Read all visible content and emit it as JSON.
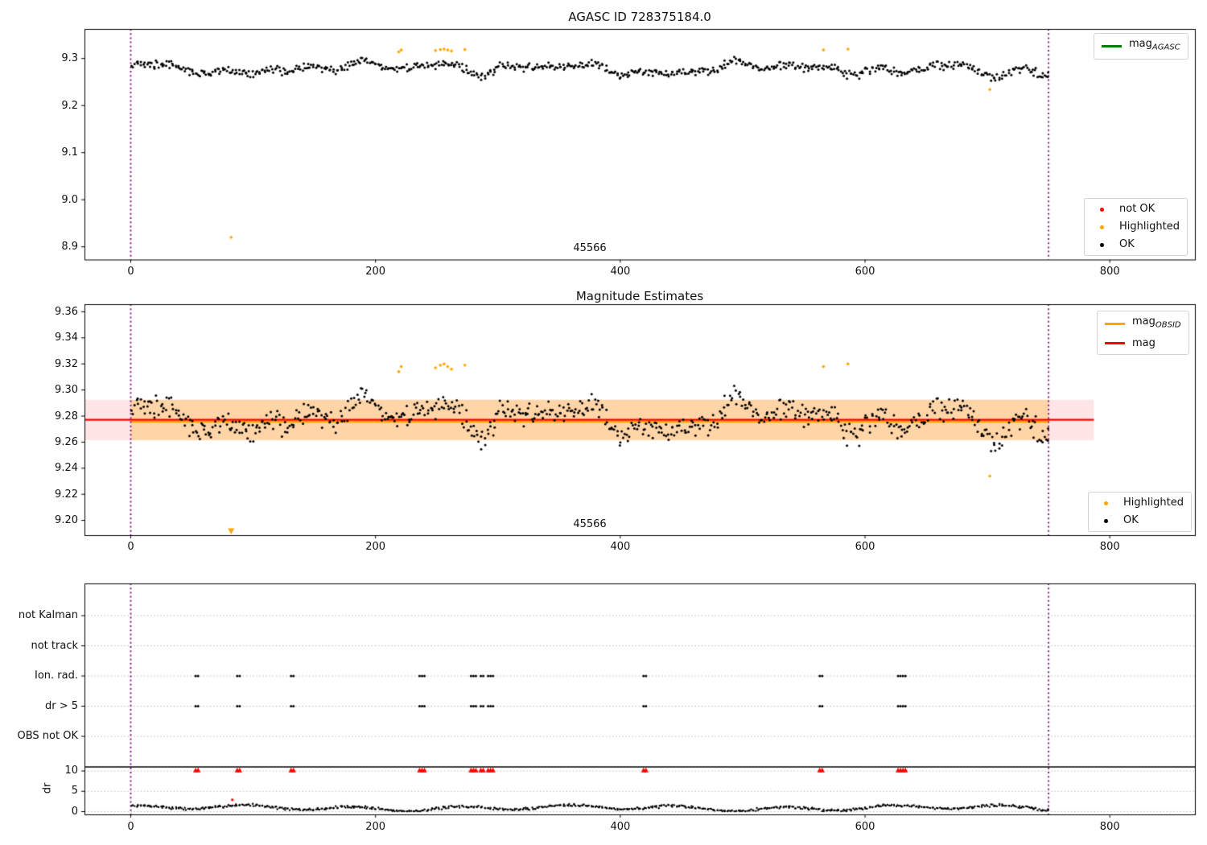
{
  "figure": {
    "background": "#ffffff"
  },
  "colors": {
    "ok": "#000000",
    "not_ok": "#ff0000",
    "highlighted": "#ffa500",
    "mag_line": "#ff0000",
    "mag_obsid_line": "#ffa500",
    "mag_agasc_line": "#008000",
    "obs_vline": "#800080",
    "grid": "#b9b9b9",
    "band_red": "rgba(255,0,0,0.10)",
    "band_orange": "rgba(255,165,0,0.28)",
    "spine": "#000000"
  },
  "plots": {
    "mag_agasc": {
      "title": "AGASC ID 728375184.0",
      "annotation": "45566",
      "xticks": [
        "0",
        "200",
        "400",
        "600",
        "800"
      ],
      "yticks": [
        "8.9",
        "9.0",
        "9.1",
        "9.2",
        "9.3"
      ],
      "legends": {
        "line": {
          "main": "mag",
          "sub": "AGASC"
        },
        "markers": [
          {
            "key": "not_ok",
            "label": "not OK"
          },
          {
            "key": "highlighted",
            "label": "Highlighted"
          },
          {
            "key": "ok",
            "label": "OK"
          }
        ]
      }
    },
    "mag_estimates": {
      "title": "Magnitude Estimates",
      "annotation": "45566",
      "xticks": [
        "0",
        "200",
        "400",
        "600",
        "800"
      ],
      "yticks": [
        "9.20",
        "9.22",
        "9.24",
        "9.26",
        "9.28",
        "9.30",
        "9.32",
        "9.34",
        "9.36"
      ],
      "legends": {
        "lines": [
          {
            "key": "mag_obsid_line",
            "main": "mag",
            "sub": "OBSID"
          },
          {
            "key": "mag_line",
            "main": "mag",
            "sub": ""
          }
        ],
        "markers": [
          {
            "key": "highlighted",
            "label": "Highlighted"
          },
          {
            "key": "ok",
            "label": "OK"
          }
        ]
      }
    },
    "flags": {
      "categories": [
        "not Kalman",
        "not track",
        "Ion. rad.",
        "dr > 5",
        "OBS not OK"
      ],
      "dr_ticks": [
        "10",
        "5",
        "0"
      ],
      "ylabel": "dr",
      "xticks": [
        "0",
        "200",
        "400",
        "600",
        "800"
      ]
    }
  },
  "chart_data": [
    {
      "type": "scatter",
      "panel": "top",
      "title": "AGASC ID 728375184.0",
      "obsid": 45566,
      "xlim": [
        -38,
        870
      ],
      "ylim": [
        8.873,
        9.368
      ],
      "xticks": [
        0,
        200,
        400,
        600,
        800
      ],
      "yticks": [
        8.9,
        9.0,
        9.1,
        9.2,
        9.3
      ],
      "obs_vlines": [
        0,
        750
      ],
      "legend_entries": [
        "mag_AGASC",
        "not OK",
        "Highlighted",
        "OK"
      ],
      "highlighted_points": [
        [
          219,
          9.314
        ],
        [
          221,
          9.318
        ],
        [
          249,
          9.317
        ],
        [
          253,
          9.319
        ],
        [
          256,
          9.32
        ],
        [
          259,
          9.318
        ],
        [
          262,
          9.316
        ],
        [
          273,
          9.319
        ],
        [
          566,
          9.318
        ],
        [
          586,
          9.32
        ],
        [
          702,
          9.234
        ],
        [
          82,
          8.92
        ]
      ],
      "not_ok_points": [],
      "ok_scatter_gen": {
        "seed": 42,
        "n": 680,
        "x_range": [
          1,
          750
        ],
        "base": 9.277,
        "waves": [
          [
            0.009,
            26,
            0.8
          ],
          [
            0.005,
            9.5,
            0
          ],
          [
            0.0045,
            6.1,
            2
          ]
        ],
        "bumps": [
          [
            252,
            26,
            0.016
          ],
          [
            570,
            20,
            0.011
          ],
          [
            100,
            18,
            0.008
          ],
          [
            700,
            22,
            -0.013
          ],
          [
            70,
            18,
            -0.009
          ]
        ],
        "noise": 0.011,
        "clamp": [
          9.24,
          9.322
        ]
      }
    },
    {
      "type": "scatter",
      "panel": "middle",
      "title": "Magnitude Estimates",
      "obsid": 45566,
      "xlim": [
        -38,
        870
      ],
      "ylim": [
        9.1886,
        9.3646
      ],
      "xticks": [
        0,
        200,
        400,
        600,
        800
      ],
      "yticks": [
        9.2,
        9.22,
        9.24,
        9.26,
        9.28,
        9.3,
        9.32,
        9.34,
        9.36
      ],
      "obs_vlines": [
        0,
        750
      ],
      "mag": 9.2772,
      "mag_band": [
        9.2615,
        9.2925
      ],
      "mag_span": [
        -38,
        787
      ],
      "mag_obsid": 9.2764,
      "mag_obsid_band": [
        9.2615,
        9.2925
      ],
      "mag_obsid_span": [
        0,
        750
      ],
      "clipped_low_point": {
        "x": 82,
        "y": 8.92,
        "marker": "triangle-down",
        "series": "Highlighted"
      },
      "legend_entries": [
        "mag_OBSID",
        "mag",
        "Highlighted",
        "OK"
      ],
      "note": "same star samples as top panel"
    },
    {
      "type": "flags-and-dr",
      "panel": "bottom",
      "categories": [
        "not Kalman",
        "not track",
        "Ion. rad.",
        "dr > 5",
        "OBS not OK"
      ],
      "not_kalman_x": [],
      "not_track_x": [],
      "obs_not_ok_x": [],
      "ion_rad_x": [
        53,
        55,
        87,
        89,
        131,
        133,
        236,
        238,
        240,
        278,
        280,
        282,
        286,
        288,
        292,
        294,
        296,
        419,
        421,
        563,
        565,
        627,
        629,
        631,
        633
      ],
      "dr_gt5_x": [
        53,
        55,
        87,
        89,
        131,
        133,
        236,
        238,
        240,
        278,
        280,
        282,
        286,
        288,
        292,
        294,
        296,
        419,
        421,
        563,
        565,
        627,
        629,
        631,
        633
      ],
      "dr_clip_x": [
        53,
        55,
        87,
        89,
        131,
        133,
        236,
        238,
        240,
        278,
        280,
        282,
        286,
        288,
        292,
        294,
        296,
        419,
        421,
        563,
        565,
        627,
        629,
        631,
        633
      ],
      "dr_ticks": [
        10,
        5,
        0
      ],
      "dr_threshold_line": 10.5,
      "dr_red_point": [
        83,
        2.9
      ],
      "dr_gen": {
        "seed": 7,
        "base": 0.9,
        "waves": [
          [
            0.5,
            14,
            1.1
          ],
          [
            0.3,
            47,
            0
          ]
        ],
        "noise": 0.4,
        "clamp": [
          0.08,
          2.5
        ]
      },
      "obs_vlines": [
        0,
        750
      ],
      "xticks": [
        0,
        200,
        400,
        600,
        800
      ]
    }
  ]
}
